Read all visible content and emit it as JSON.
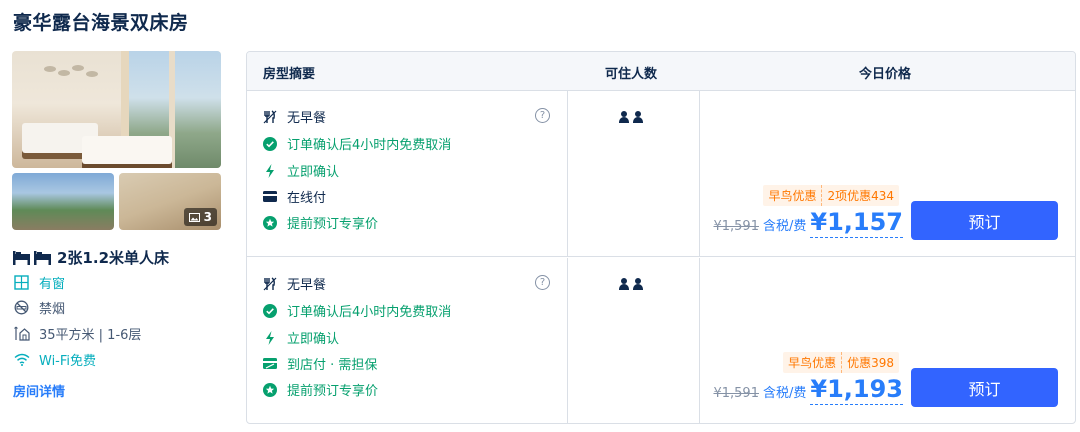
{
  "room": {
    "title": "豪华露台海景双床房",
    "photo_count": "3",
    "bed": "2张1.2米单人床",
    "features": {
      "window": "有窗",
      "smoking": "禁烟",
      "area": "35平方米 | 1-6层",
      "wifi": "Wi-Fi免费"
    },
    "details_link": "房间详情"
  },
  "table": {
    "headers": {
      "summary": "房型摘要",
      "occupancy": "可住人数",
      "price": "今日价格"
    },
    "rows": [
      {
        "meal": "无早餐",
        "cancel": "订单确认后4小时内免费取消",
        "confirm": "立即确认",
        "payment": "在线付",
        "payment_icon": "credit-card-icon",
        "early": "提前预订专享价",
        "guests": 2,
        "badge_early": "早鸟优惠",
        "badge_discount": "2项优惠434",
        "original_price": "¥1,591",
        "tax_note": "含税/费",
        "price": "¥1,157",
        "book_label": "预订"
      },
      {
        "meal": "无早餐",
        "cancel": "订单确认后4小时内免费取消",
        "confirm": "立即确认",
        "payment": "到店付 · 需担保",
        "payment_icon": "guarantee-card-icon",
        "early": "提前预订专享价",
        "guests": 2,
        "badge_early": "早鸟优惠",
        "badge_discount": "优惠398",
        "original_price": "¥1,591",
        "tax_note": "含税/费",
        "price": "¥1,193",
        "book_label": "预订"
      }
    ]
  },
  "colors": {
    "brand_blue": "#287dfa",
    "button_blue": "#3264ff",
    "green": "#06a06e",
    "orange": "#ff7700",
    "teal": "#06aebd"
  }
}
